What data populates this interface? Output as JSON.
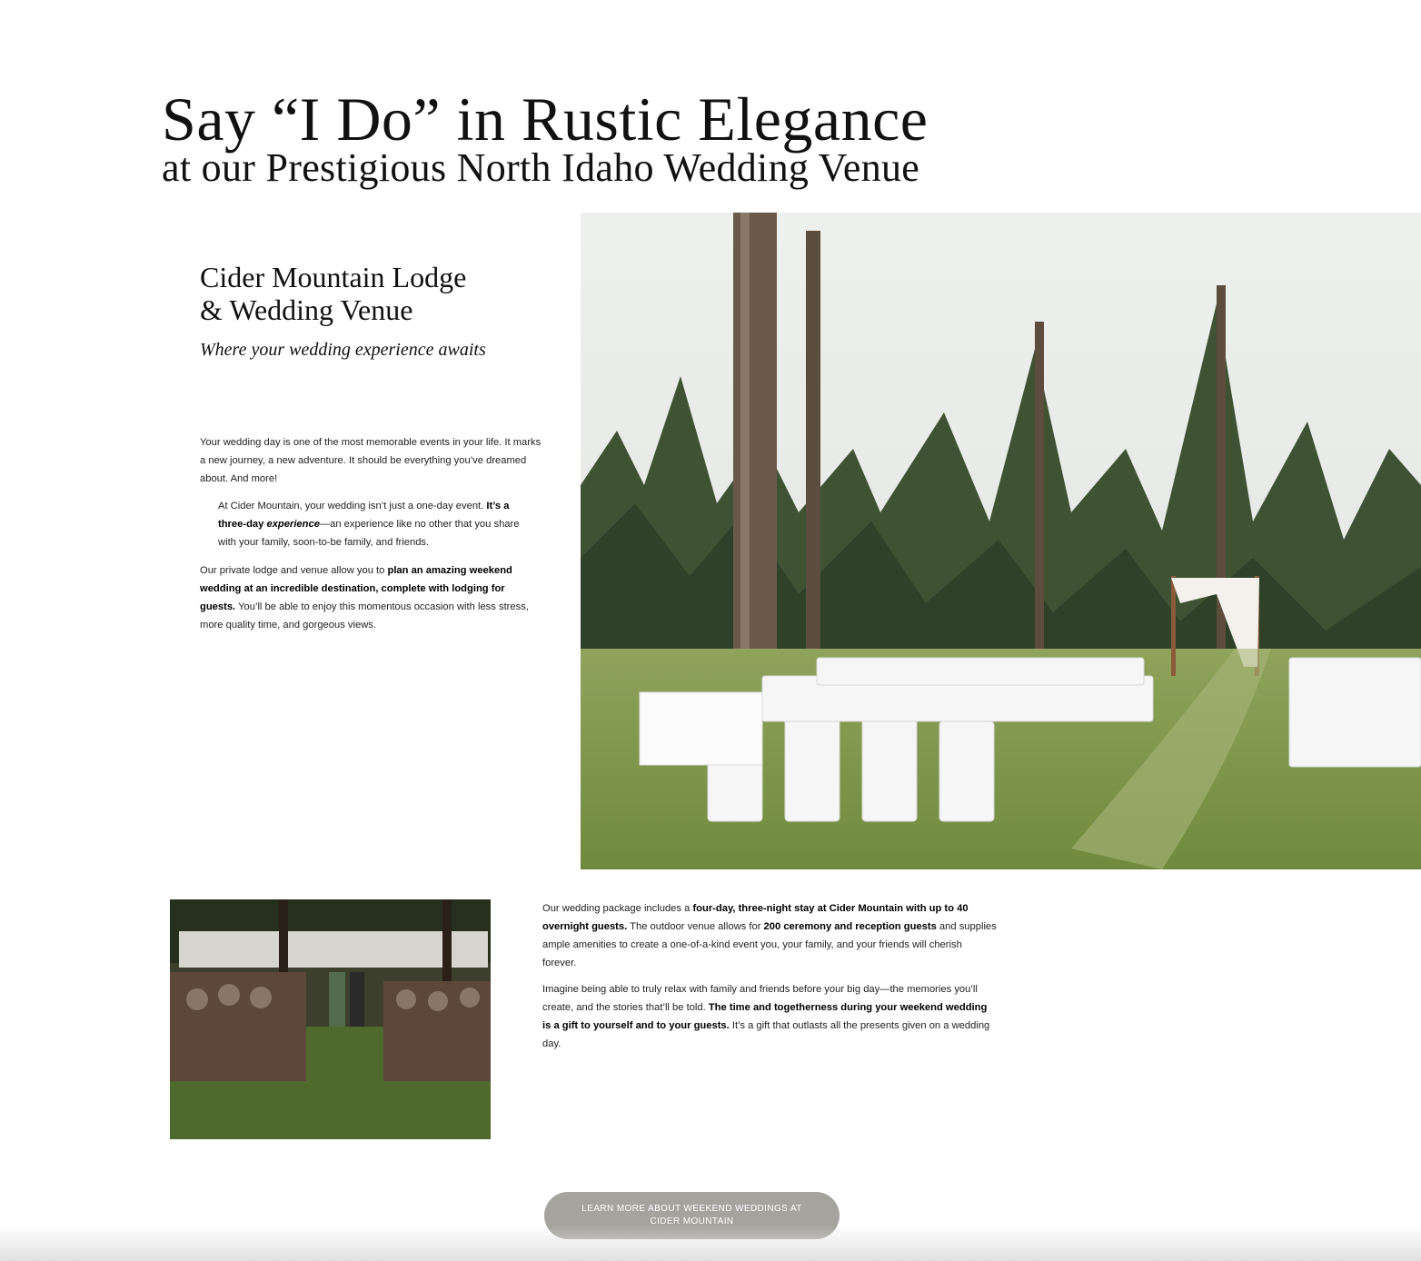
{
  "hero": {
    "title_line1": "Say “I Do” in Rustic Elegance",
    "title_line2": "at our Prestigious North Idaho Wedding Venue"
  },
  "intro": {
    "venue_name_line1": "Cider Mountain Lodge",
    "venue_name_line2": "& Wedding Venue",
    "tagline": "Where your wedding experience awaits"
  },
  "body": {
    "p1": "Your wedding day is one of the most memorable events in your life. It marks a new journey, a new adventure. It should be everything you’ve dreamed about. And more!",
    "p2_a": "At Cider Mountain, your wedding isn’t just a one-day event. ",
    "p2_b": "It’s a three-day ",
    "p2_c": "experience",
    "p2_d": "—an experience like no other that you share with your family, soon-to-be family, and friends.",
    "p3_a": "Our private lodge and venue allow you to ",
    "p3_b": "plan an amazing weekend wedding at an incredible destination, complete with lodging for guests.",
    "p3_c": " You’ll be able to enjoy this momentous occasion with less stress, more quality time, and gorgeous views.",
    "p4_a": "Our wedding package includes a ",
    "p4_b": "four-day, three-night stay at Cider Mountain with up to 40 overnight guests.",
    "p4_c": " The outdoor venue allows for ",
    "p4_d": "200 ceremony and reception guests",
    "p4_e": " and supplies ample amenities to create a one-of-a-kind event you, your family, and your friends will cherish forever.",
    "p5_a": "Imagine being able to truly relax with family and friends before your big day—the memories you’ll create, and the stories that’ll be told. ",
    "p5_b": "The time and togetherness during your weekend wedding is a gift to yourself and to your guests.",
    "p5_c": " It’s a gift that outlasts all the presents given on a wedding day."
  },
  "cta": {
    "label": "LEARN MORE ABOUT WEEKEND WEDDINGS AT CIDER MOUNTAIN"
  },
  "colors": {
    "button_bg": "#a4a39e",
    "text": "#111111"
  }
}
